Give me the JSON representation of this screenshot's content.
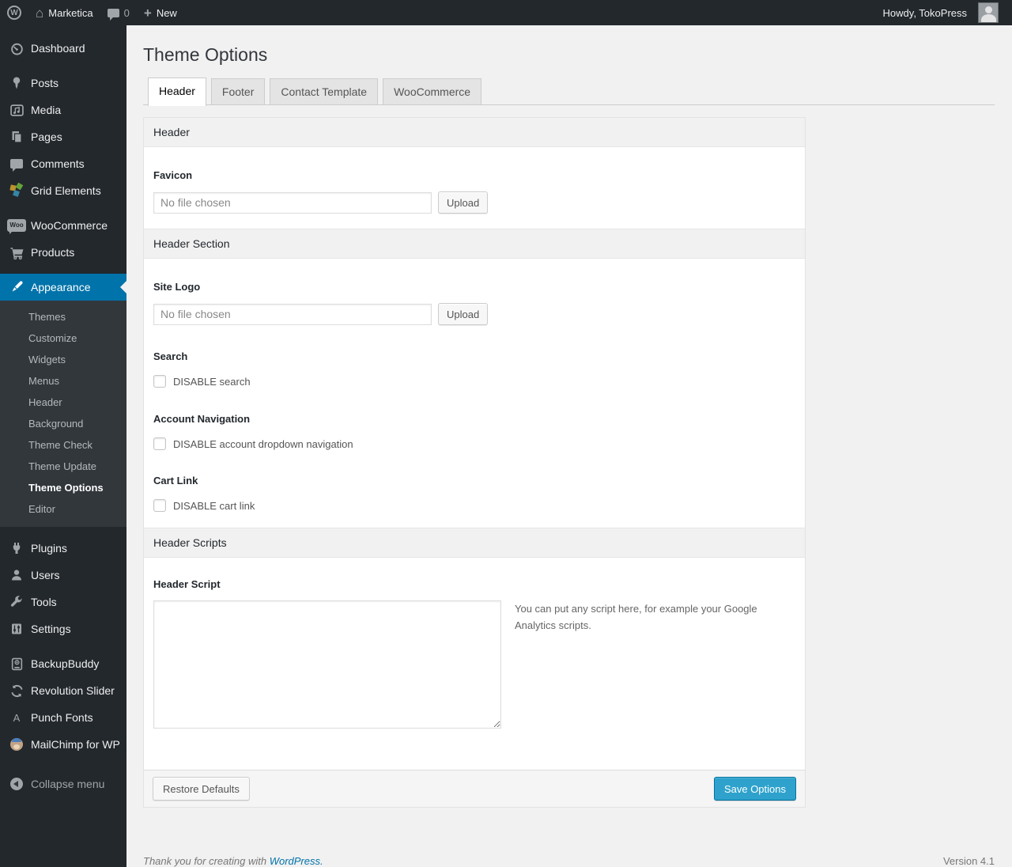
{
  "colors": {
    "accent": "#0073aa",
    "primary_button": "#2ea2cc",
    "admin_bar_bg": "#23282d",
    "menu_bg": "#23282d",
    "submenu_bg": "#32373c",
    "page_bg": "#f1f1f1"
  },
  "admin_bar": {
    "wp_logo_letter": "W",
    "site_name": "Marketica",
    "comment_count": "0",
    "new_label": "New",
    "plus_glyph": "+",
    "home_glyph": "⌂",
    "howdy": "Howdy, TokoPress"
  },
  "sidebar": {
    "dashboard": "Dashboard",
    "posts": "Posts",
    "media": "Media",
    "pages": "Pages",
    "comments": "Comments",
    "grid_elements": "Grid Elements",
    "woocommerce": "WooCommerce",
    "woo_badge": "Woo",
    "products": "Products",
    "appearance": "Appearance",
    "appearance_submenu": {
      "themes": "Themes",
      "customize": "Customize",
      "widgets": "Widgets",
      "menus": "Menus",
      "header": "Header",
      "background": "Background",
      "theme_check": "Theme Check",
      "theme_update": "Theme Update",
      "theme_options": "Theme Options",
      "editor": "Editor"
    },
    "plugins": "Plugins",
    "users": "Users",
    "tools": "Tools",
    "settings": "Settings",
    "backupbuddy": "BackupBuddy",
    "revolution_slider": "Revolution Slider",
    "punch_fonts": "Punch Fonts",
    "punch_fonts_letter": "A",
    "mailchimp": "MailChimp for WP",
    "collapse_menu": "Collapse menu"
  },
  "main": {
    "page_title": "Theme Options",
    "tabs": {
      "header": "Header",
      "footer": "Footer",
      "contact_template": "Contact Template",
      "woocommerce": "WooCommerce"
    },
    "sections": {
      "header": "Header",
      "header_section": "Header Section",
      "header_scripts": "Header Scripts"
    },
    "fields": {
      "favicon": {
        "label": "Favicon",
        "file_value": "No file chosen",
        "upload_label": "Upload"
      },
      "site_logo": {
        "label": "Site Logo",
        "file_value": "No file chosen",
        "upload_label": "Upload"
      },
      "search": {
        "label": "Search",
        "checkbox_label": "DISABLE search",
        "checked": false
      },
      "account_navigation": {
        "label": "Account Navigation",
        "checkbox_label": "DISABLE account dropdown navigation",
        "checked": false
      },
      "cart_link": {
        "label": "Cart Link",
        "checkbox_label": "DISABLE cart link",
        "checked": false
      },
      "header_script": {
        "label": "Header Script",
        "value": "",
        "note": "You can put any script here, for example your Google Analytics scripts."
      }
    },
    "actions": {
      "restore_defaults": "Restore Defaults",
      "save_options": "Save Options"
    }
  },
  "footer": {
    "thanks_prefix": "Thank you for creating with ",
    "wordpress_link": "WordPress.",
    "version": "Version 4.1"
  }
}
